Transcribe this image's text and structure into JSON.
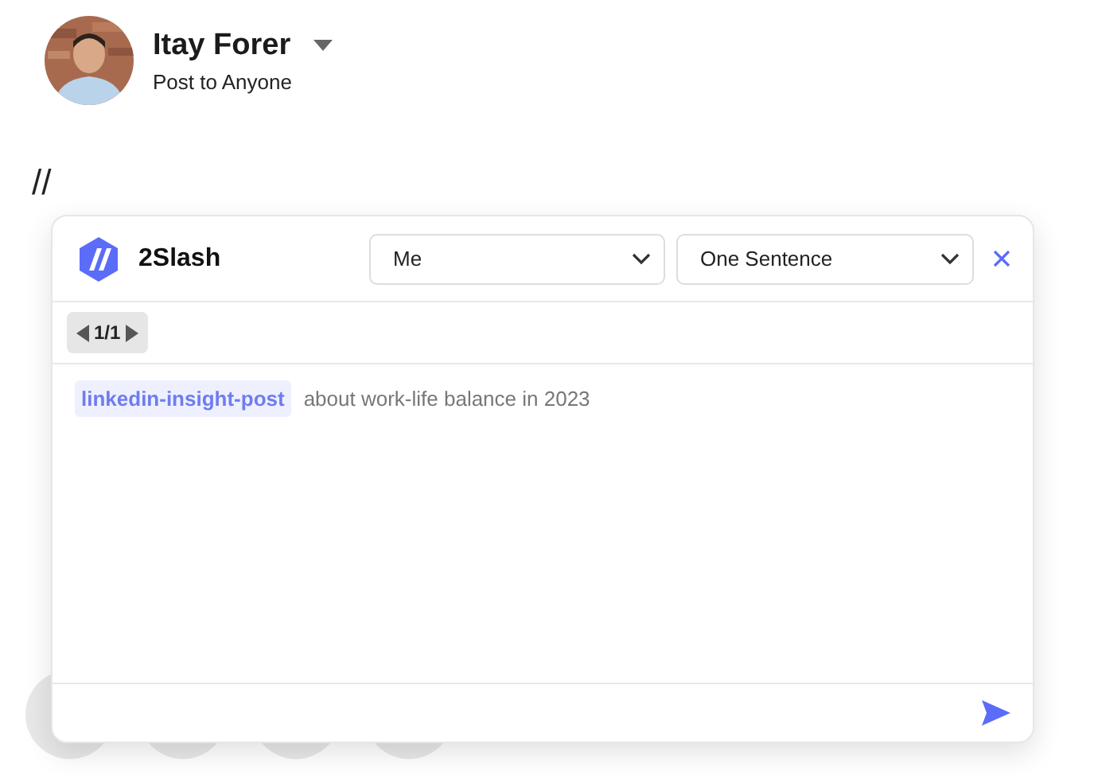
{
  "author": {
    "name": "Itay Forer",
    "audience": "Post to Anyone"
  },
  "editor": {
    "text": "//"
  },
  "assistant": {
    "title": "2Slash",
    "selects": [
      {
        "value": "Me"
      },
      {
        "value": "One Sentence"
      }
    ],
    "pager": "1/1",
    "prompt": {
      "command": "linkedin-insight-post",
      "text": "about work-life balance in 2023"
    }
  }
}
